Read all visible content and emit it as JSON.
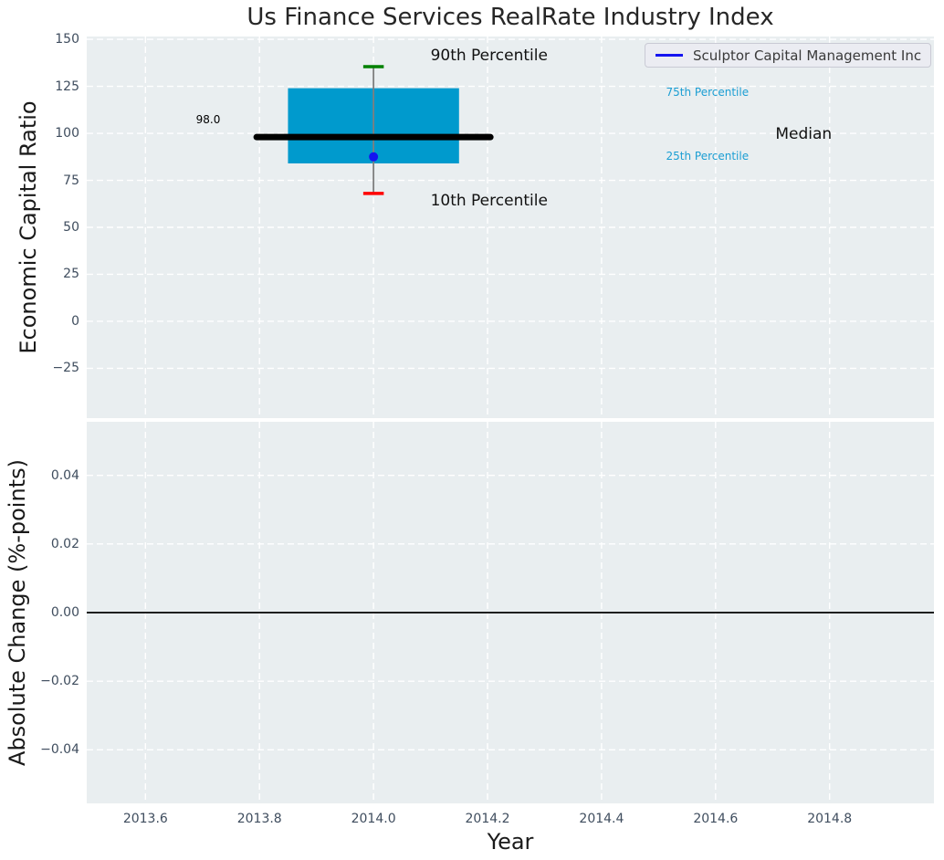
{
  "title": "Us Finance Services RealRate Industry Index",
  "legend": {
    "label": "Sculptor Capital Management Inc",
    "position": "upper right"
  },
  "colors": {
    "plot_bg": "#E9EEF0",
    "grid": "#FFFFFF",
    "box": "#009ACD",
    "median_line": "#000000",
    "whisker": "#7F7F7F",
    "cap_90th": "#008000",
    "cap_10th": "#FF0000",
    "company_marker": "#1414F0",
    "percentile_text": "#1B9ED3",
    "tick_text": "#3F4D5E",
    "label_text": "#1A1A1A",
    "zero_line": "#000000"
  },
  "chart_data": [
    {
      "type": "boxplot",
      "title": "Us Finance Services RealRate Industry Index",
      "ylabel": "Economic Capital Ratio",
      "xlabel": "",
      "xlim": [
        2013.497,
        2014.983
      ],
      "ylim": [
        -51.5,
        151.5
      ],
      "grid": true,
      "legend_entries": [
        "Sculptor Capital Management Inc"
      ],
      "xticks": {
        "values": [
          2013.6,
          2013.8,
          2014.0,
          2014.2,
          2014.4,
          2014.6,
          2014.8
        ],
        "labels": []
      },
      "yticks": {
        "values": [
          150,
          125,
          100,
          75,
          50,
          25,
          0,
          -25
        ],
        "labels": [
          "150",
          "125",
          "100",
          "75",
          "50",
          "25",
          "0",
          "−25"
        ]
      },
      "box": {
        "x": 2014.0,
        "p10": 68,
        "p25": 84,
        "median": 98.0,
        "p75": 124,
        "p90": 135.5,
        "company": "Sculptor Capital Management Inc",
        "company_value": 87.5,
        "box_halfwidth": 0.15,
        "median_halfwidth": 0.205,
        "cap_halfwidth": 0.018
      },
      "annotations": [
        {
          "text": "90th Percentile",
          "x": 2014.1,
          "y": 141,
          "size": 17,
          "color": "#111111",
          "align": "left"
        },
        {
          "text": "10th Percentile",
          "x": 2014.1,
          "y": 63.5,
          "size": 17,
          "color": "#111111",
          "align": "left"
        },
        {
          "text": "Median",
          "x": 2014.705,
          "y": 99,
          "size": 17,
          "color": "#111111",
          "align": "left"
        },
        {
          "text": "75th Percentile",
          "x": 2014.513,
          "y": 121.5,
          "size": 12,
          "color": "#1B9ED3",
          "align": "left"
        },
        {
          "text": "25th Percentile",
          "x": 2014.513,
          "y": 87.5,
          "size": 12,
          "color": "#1B9ED3",
          "align": "left"
        },
        {
          "text": "98.0",
          "x": 2013.71,
          "y": 107,
          "size": 12,
          "color": "#000000",
          "align": "center"
        }
      ]
    },
    {
      "type": "line",
      "ylabel": "Absolute Change (%-points)",
      "xlabel": "Year",
      "xlim": [
        2013.497,
        2014.983
      ],
      "ylim": [
        -0.0556,
        0.0556
      ],
      "grid": true,
      "zero_line": 0.0,
      "xticks": {
        "values": [
          2013.6,
          2013.8,
          2014.0,
          2014.2,
          2014.4,
          2014.6,
          2014.8
        ],
        "labels": [
          "2013.6",
          "2013.8",
          "2014.0",
          "2014.2",
          "2014.4",
          "2014.6",
          "2014.8"
        ]
      },
      "yticks": {
        "values": [
          0.04,
          0.02,
          0.0,
          -0.02,
          -0.04
        ],
        "labels": [
          "0.04",
          "0.02",
          "0.00",
          "−0.02",
          "−0.04"
        ]
      }
    }
  ]
}
